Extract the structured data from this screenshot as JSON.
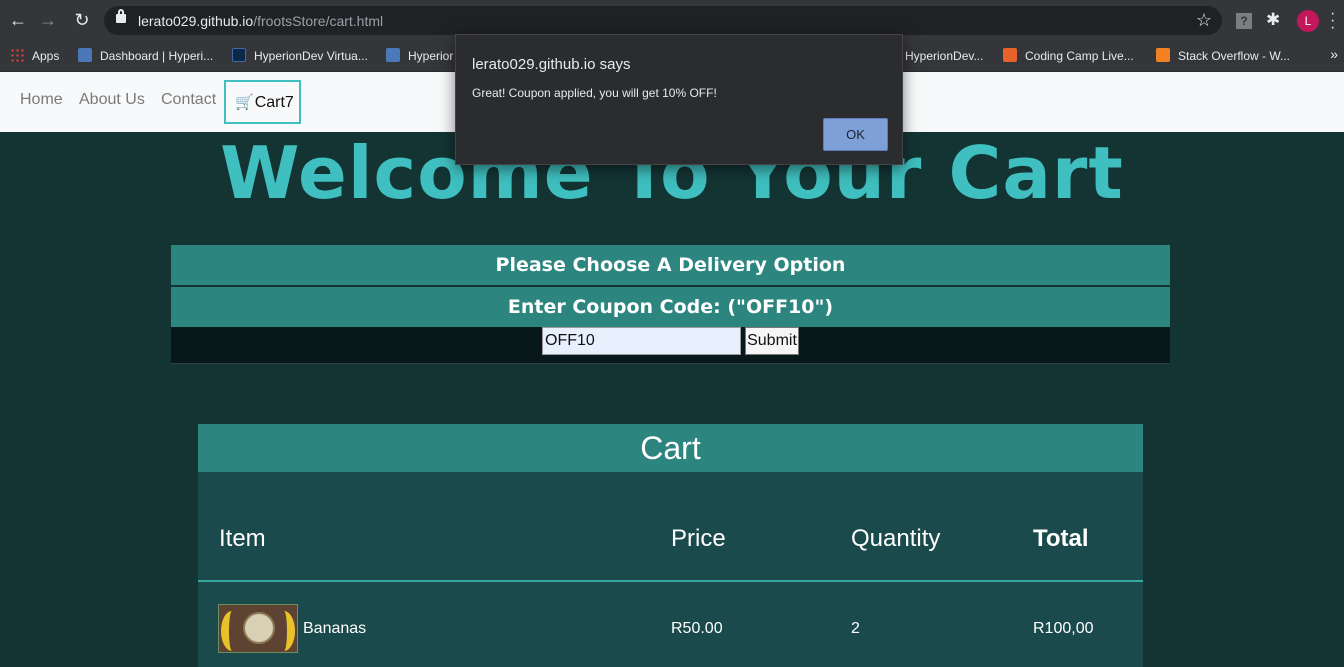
{
  "browser": {
    "url_host": "lerato029.github.io",
    "url_path": "/frootsStore/cart.html",
    "profile_initial": "L",
    "help_glyph": "?",
    "bookmarks": [
      {
        "label": "Apps",
        "icon": "apps-grid-icon"
      },
      {
        "label": "Dashboard | Hyperi...",
        "icon": "hyperion-icon"
      },
      {
        "label": "HyperionDev Virtua...",
        "icon": "hyperiondev-icon"
      },
      {
        "label": "Hyperior",
        "icon": "hyperion-icon"
      },
      {
        "label": "HyperionDev...",
        "icon": "hyperiondev-icon"
      },
      {
        "label": "Coding Camp Live...",
        "icon": "coding-camp-icon"
      },
      {
        "label": "Stack Overflow - W...",
        "icon": "stackoverflow-icon"
      }
    ],
    "more_glyph": "»"
  },
  "nav": {
    "home": "Home",
    "about": "About Us",
    "contact": "Contact",
    "cart_label": "Cart",
    "cart_count": "7"
  },
  "hero": {
    "title": "Welcome To Your Cart"
  },
  "delivery": {
    "heading": "Please Choose A Delivery Option"
  },
  "coupon": {
    "heading": "Enter Coupon Code: (\"OFF10\")",
    "value": "OFF10",
    "submit_label": "Submit"
  },
  "cart": {
    "heading": "Cart",
    "columns": {
      "item": "Item",
      "price": "Price",
      "quantity": "Quantity",
      "total": "Total"
    },
    "rows": [
      {
        "item": "Bananas",
        "price": "R50.00",
        "quantity": "2",
        "total": "R100,00"
      }
    ]
  },
  "dialog": {
    "title": "lerato029.github.io says",
    "message": "Great! Coupon applied, you will get 10% OFF!",
    "ok_label": "OK"
  },
  "colors": {
    "accent": "#3fbfbf",
    "bar": "#2d8580",
    "page_bg": "#143434",
    "dialog_ok": "#7f9fd8"
  }
}
